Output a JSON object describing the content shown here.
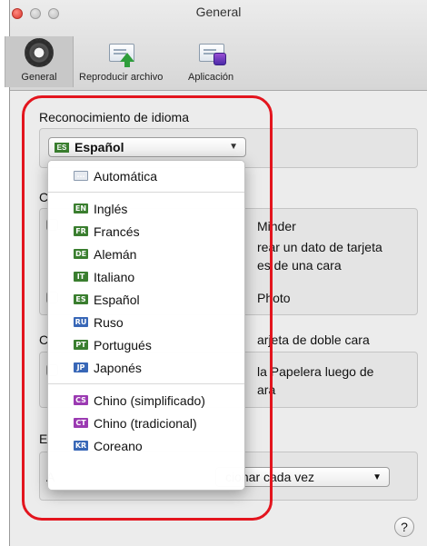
{
  "window": {
    "title": "General"
  },
  "toolbar": {
    "items": [
      {
        "label": "General"
      },
      {
        "label": "Reproducir archivo"
      },
      {
        "label": "Aplicación"
      }
    ]
  },
  "groups": {
    "language_title": "Reconocimiento de idioma",
    "language_selected": "Español",
    "language_selected_code": "ES",
    "export_title_partial": "C",
    "cardminder_partial": "Minder",
    "create_text_1": "rear un dato de tarjeta",
    "create_text_2": "es de una cara",
    "photo_text": "Photo",
    "double_title_1": "C",
    "double_title_2": "arjeta de doble cara",
    "trash_text_1": "la Papelera luego de",
    "trash_text_2": "ara",
    "bottom_label_partial": "E",
    "bottom_row_partial": "A",
    "bottom_select_value": "cionar cada vez"
  },
  "menu": {
    "items": [
      {
        "code": "···",
        "label": "Automática",
        "color": "auto"
      },
      {
        "code": "EN",
        "label": "Inglés",
        "color": "green"
      },
      {
        "code": "FR",
        "label": "Francés",
        "color": "green"
      },
      {
        "code": "DE",
        "label": "Alemán",
        "color": "green"
      },
      {
        "code": "IT",
        "label": "Italiano",
        "color": "green"
      },
      {
        "code": "ES",
        "label": "Español",
        "color": "green"
      },
      {
        "code": "RU",
        "label": "Ruso",
        "color": "blue"
      },
      {
        "code": "PT",
        "label": "Portugués",
        "color": "green"
      },
      {
        "code": "JP",
        "label": "Japonés",
        "color": "blue"
      },
      {
        "code": "CS",
        "label": "Chino (simplificado)",
        "color": "purple"
      },
      {
        "code": "CT",
        "label": "Chino (tradicional)",
        "color": "purple"
      },
      {
        "code": "KR",
        "label": "Coreano",
        "color": "blue"
      }
    ]
  },
  "help": {
    "label": "?"
  },
  "colors": {
    "highlight": "#e3151e",
    "flag_green": "#3a7e2f",
    "flag_blue": "#3867b7",
    "flag_purple": "#9b3ab2"
  }
}
